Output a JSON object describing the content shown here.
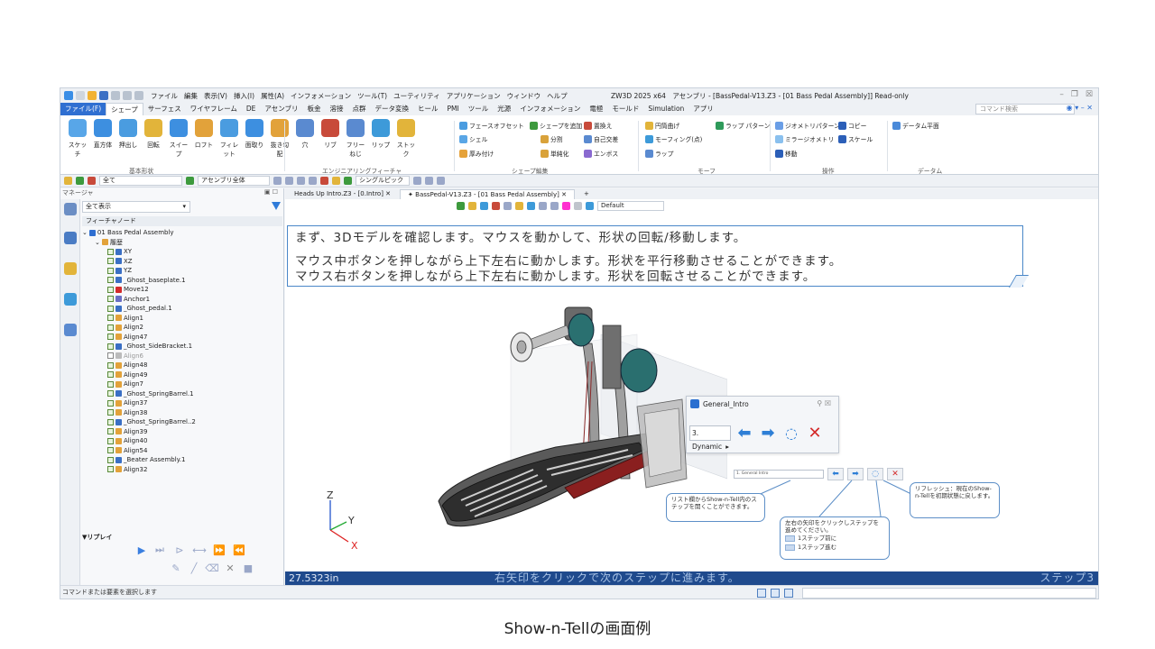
{
  "window": {
    "title": "ZW3D 2025 x64　アセンブリ - [BassPedal-V13.Z3 - [01 Bass Pedal Assembly]] Read-only",
    "menu": [
      "ファイル",
      "編集",
      "表示(V)",
      "挿入(I)",
      "属性(A)",
      "インフォメーション",
      "ツール(T)",
      "ユーティリティ",
      "アプリケーション",
      "ウィンドウ",
      "ヘルプ"
    ]
  },
  "ribbon": {
    "tabs": [
      "ファイル(F)",
      "シェープ",
      "サーフェス",
      "ワイヤフレーム",
      "DE",
      "アセンブリ",
      "板金",
      "溶接",
      "点群",
      "データ変換",
      "ヒール",
      "PMI",
      "ツール",
      "光源",
      "インフォメーション",
      "電極",
      "モールド",
      "Simulation",
      "アプリ"
    ],
    "search_placeholder": "コマンド検索",
    "big_buttons": [
      "スケッチ",
      "直方体",
      "押出し",
      "回転",
      "スイープ",
      "ロフト",
      "フィレット",
      "面取り",
      "抜き勾配",
      "穴",
      "リブ",
      "フリーねじ",
      "リップ",
      "ストック"
    ],
    "groups": [
      "基本形状",
      "エンジニアリングフィーチャ",
      "シェープ編集",
      "モーフ",
      "操作",
      "データム"
    ],
    "small_buttons": [
      "フェースオフセット",
      "シェル",
      "厚み付け",
      "シェープを追加",
      "分割",
      "単純化",
      "置換え",
      "自己交差",
      "エンボス",
      "円筒曲げ",
      "モーフィング(点)",
      "ラップ",
      "ラップ パターン",
      "ジオメトリパターン",
      "ミラージオメトリ",
      "移動",
      "コピー",
      "スケール",
      "データム平面"
    ]
  },
  "toolbar": {
    "filter_all": "全て",
    "assembly_all": "アセンブリ全体",
    "pick_mode": "シングルピック"
  },
  "manager": {
    "title": "マネージャ",
    "filter_label": "全て表示",
    "tree_header": "フィーチャノード",
    "tree": [
      {
        "label": "01 Bass Pedal Assembly",
        "depth": 0,
        "kind": "asm"
      },
      {
        "label": "履歴",
        "depth": 1,
        "kind": "hist"
      },
      {
        "label": "XY",
        "depth": 2,
        "kind": "plane"
      },
      {
        "label": "XZ",
        "depth": 2,
        "kind": "plane"
      },
      {
        "label": "YZ",
        "depth": 2,
        "kind": "plane"
      },
      {
        "label": "_Ghost_baseplate.1",
        "depth": 2,
        "kind": "part"
      },
      {
        "label": "Move12",
        "depth": 2,
        "kind": "move"
      },
      {
        "label": "Anchor1",
        "depth": 2,
        "kind": "anchor"
      },
      {
        "label": "_Ghost_pedal.1",
        "depth": 2,
        "kind": "part"
      },
      {
        "label": "Align1",
        "depth": 2,
        "kind": "align"
      },
      {
        "label": "Align2",
        "depth": 2,
        "kind": "align"
      },
      {
        "label": "Align47",
        "depth": 2,
        "kind": "align"
      },
      {
        "label": "_Ghost_SideBracket.1",
        "depth": 2,
        "kind": "part"
      },
      {
        "label": "Align6",
        "depth": 2,
        "kind": "align-off"
      },
      {
        "label": "Align48",
        "depth": 2,
        "kind": "align"
      },
      {
        "label": "Align49",
        "depth": 2,
        "kind": "align"
      },
      {
        "label": "Align7",
        "depth": 2,
        "kind": "align"
      },
      {
        "label": "_Ghost_SpringBarrel.1",
        "depth": 2,
        "kind": "part"
      },
      {
        "label": "Align37",
        "depth": 2,
        "kind": "align"
      },
      {
        "label": "Align38",
        "depth": 2,
        "kind": "align"
      },
      {
        "label": "_Ghost_SpringBarrel..2",
        "depth": 2,
        "kind": "part"
      },
      {
        "label": "Align39",
        "depth": 2,
        "kind": "align"
      },
      {
        "label": "Align40",
        "depth": 2,
        "kind": "align"
      },
      {
        "label": "Align54",
        "depth": 2,
        "kind": "align"
      },
      {
        "label": "_Beater Assembly.1",
        "depth": 2,
        "kind": "part"
      },
      {
        "label": "Align32",
        "depth": 2,
        "kind": "align"
      }
    ],
    "replay_label": "▼リプレイ"
  },
  "doc_tabs": [
    "Heads Up Intro.Z3 - [0.Intro]",
    "BassPedal-V13.Z3 - [01 Bass Pedal Assembly]"
  ],
  "view": {
    "style_label": "Default",
    "message_line1": "まず、3Dモデルを確認します。マウスを動かして、形状の回転/移動します。",
    "message_line2": "マウス中ボタンを押しながら上下左右に動かします。形状を平行移動させることができます。",
    "message_line3": "マウス右ボタンを押しながら上下左右に動かします。形状を回転させることができます。",
    "axis_z": "Z",
    "axis_y": "Y",
    "axis_x": "X"
  },
  "dialog": {
    "title": "General_Intro",
    "step_value": "3. Dynamic"
  },
  "mini_toolbar": {
    "combo_value": "1. General Intro"
  },
  "callouts": {
    "list": "リスト欄からShow-n-Tell内のステップを開くことができます。",
    "arrows_title": "左右の矢印をクリックしステップを進めてください。",
    "prev": "1ステップ前に",
    "next": "1ステップ進む",
    "refresh": "リフレッシュ：現在のShow-n-Tellを初期状態に戻します。"
  },
  "bottom_bar": {
    "distance": "27.5323in",
    "hint": "右矢印をクリックで次のステップに進みます。",
    "step": "ステップ3"
  },
  "status": {
    "prompt": "コマンドまたは要素を選択します"
  },
  "caption": "Show-n-Tellの画面例",
  "colors": {
    "accent": "#2f6fd1",
    "frame_blue": "#4a87c8",
    "bar_navy": "#1f4a8d",
    "close_red": "#d42a2a",
    "arrow_blue": "#2e7fd6"
  }
}
